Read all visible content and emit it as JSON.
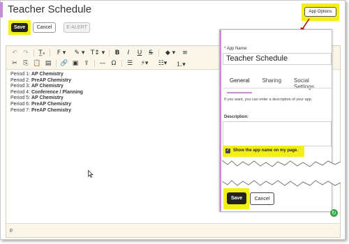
{
  "page": {
    "title": "Teacher Schedule",
    "accent_color": "#c98ad6",
    "highlight_color": "#f4f017"
  },
  "top_buttons": {
    "save": "Save",
    "cancel": "Cancel",
    "ealert": "E-ALERT",
    "app_options": "App Options"
  },
  "toolbar": {
    "row1": [
      {
        "icon": "undo-icon",
        "glyph": "↶",
        "enabled": false
      },
      {
        "icon": "redo-icon",
        "glyph": "↷",
        "enabled": false
      },
      {
        "icon": "clear-format-icon",
        "glyph": "T̲ₓ"
      },
      {
        "icon": "font-family-icon",
        "glyph": "F ▾"
      },
      {
        "icon": "paint-icon",
        "glyph": "✎ ▾"
      },
      {
        "icon": "font-size-icon",
        "glyph": "T↕ ▾"
      },
      {
        "icon": "bold-icon",
        "glyph": "B"
      },
      {
        "icon": "italic-icon",
        "glyph": "I"
      },
      {
        "icon": "underline-icon",
        "glyph": "U"
      },
      {
        "icon": "strikethrough-icon",
        "glyph": "S"
      },
      {
        "icon": "color-fill-icon",
        "glyph": "◆ ▾"
      },
      {
        "icon": "align-icon",
        "glyph": "≡"
      }
    ],
    "row2": [
      {
        "icon": "cut-icon",
        "glyph": "✂"
      },
      {
        "icon": "copy-icon",
        "glyph": "⎘"
      },
      {
        "icon": "paste-icon",
        "glyph": "📋"
      },
      {
        "icon": "paste-text-icon",
        "glyph": "▤"
      },
      {
        "icon": "link-icon",
        "glyph": "🔗"
      },
      {
        "icon": "image-icon",
        "glyph": "▣"
      },
      {
        "icon": "upload-icon",
        "glyph": "⇪"
      },
      {
        "icon": "horizontal-rule-icon",
        "glyph": "—"
      },
      {
        "icon": "omega-icon",
        "glyph": "Ω"
      },
      {
        "icon": "template-icon",
        "glyph": "☰"
      },
      {
        "icon": "lightning-icon",
        "glyph": "⚡▾"
      },
      {
        "icon": "bullet-list-icon",
        "glyph": "☷▾"
      },
      {
        "icon": "numbered-list-icon",
        "glyph": "⒈▾"
      }
    ]
  },
  "content": {
    "periods": [
      {
        "label": "Period 1:",
        "course": "AP Chemistry"
      },
      {
        "label": "Period 2:",
        "course": "PreAP Chemistry"
      },
      {
        "label": "Period 3:",
        "course": "AP Chemistry"
      },
      {
        "label": "Period 4:",
        "course": "Conference / Planning"
      },
      {
        "label": "Period 5:",
        "course": "AP Chemistry"
      },
      {
        "label": "Period 6:",
        "course": "PreAP Chemistry"
      },
      {
        "label": "Period 7:",
        "course": "PreAP Chemistry"
      }
    ]
  },
  "statusbar": {
    "path": "p"
  },
  "app_options_panel": {
    "app_name_label": "App Name:",
    "required_marker": "*",
    "app_name_value": "Teacher Schedule",
    "tabs": [
      "General",
      "Sharing",
      "Social Settings"
    ],
    "active_tab": "General",
    "description_hint": "If you want, you can enter a description of your app.",
    "description_label": "Description:",
    "show_name_label": "Show the app name on my page.",
    "show_name_checked": true,
    "save": "Save",
    "cancel": "Cancel"
  }
}
